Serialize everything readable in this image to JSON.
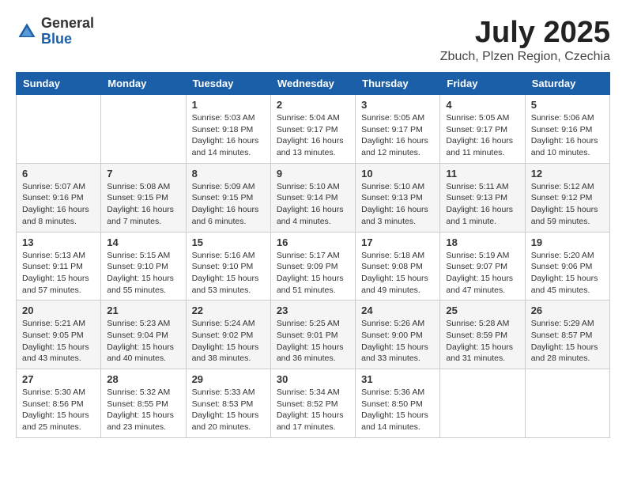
{
  "logo": {
    "general": "General",
    "blue": "Blue"
  },
  "title": "July 2025",
  "location": "Zbuch, Plzen Region, Czechia",
  "headers": [
    "Sunday",
    "Monday",
    "Tuesday",
    "Wednesday",
    "Thursday",
    "Friday",
    "Saturday"
  ],
  "weeks": [
    [
      {
        "day": "",
        "info": ""
      },
      {
        "day": "",
        "info": ""
      },
      {
        "day": "1",
        "info": "Sunrise: 5:03 AM\nSunset: 9:18 PM\nDaylight: 16 hours and 14 minutes."
      },
      {
        "day": "2",
        "info": "Sunrise: 5:04 AM\nSunset: 9:17 PM\nDaylight: 16 hours and 13 minutes."
      },
      {
        "day": "3",
        "info": "Sunrise: 5:05 AM\nSunset: 9:17 PM\nDaylight: 16 hours and 12 minutes."
      },
      {
        "day": "4",
        "info": "Sunrise: 5:05 AM\nSunset: 9:17 PM\nDaylight: 16 hours and 11 minutes."
      },
      {
        "day": "5",
        "info": "Sunrise: 5:06 AM\nSunset: 9:16 PM\nDaylight: 16 hours and 10 minutes."
      }
    ],
    [
      {
        "day": "6",
        "info": "Sunrise: 5:07 AM\nSunset: 9:16 PM\nDaylight: 16 hours and 8 minutes."
      },
      {
        "day": "7",
        "info": "Sunrise: 5:08 AM\nSunset: 9:15 PM\nDaylight: 16 hours and 7 minutes."
      },
      {
        "day": "8",
        "info": "Sunrise: 5:09 AM\nSunset: 9:15 PM\nDaylight: 16 hours and 6 minutes."
      },
      {
        "day": "9",
        "info": "Sunrise: 5:10 AM\nSunset: 9:14 PM\nDaylight: 16 hours and 4 minutes."
      },
      {
        "day": "10",
        "info": "Sunrise: 5:10 AM\nSunset: 9:13 PM\nDaylight: 16 hours and 3 minutes."
      },
      {
        "day": "11",
        "info": "Sunrise: 5:11 AM\nSunset: 9:13 PM\nDaylight: 16 hours and 1 minute."
      },
      {
        "day": "12",
        "info": "Sunrise: 5:12 AM\nSunset: 9:12 PM\nDaylight: 15 hours and 59 minutes."
      }
    ],
    [
      {
        "day": "13",
        "info": "Sunrise: 5:13 AM\nSunset: 9:11 PM\nDaylight: 15 hours and 57 minutes."
      },
      {
        "day": "14",
        "info": "Sunrise: 5:15 AM\nSunset: 9:10 PM\nDaylight: 15 hours and 55 minutes."
      },
      {
        "day": "15",
        "info": "Sunrise: 5:16 AM\nSunset: 9:10 PM\nDaylight: 15 hours and 53 minutes."
      },
      {
        "day": "16",
        "info": "Sunrise: 5:17 AM\nSunset: 9:09 PM\nDaylight: 15 hours and 51 minutes."
      },
      {
        "day": "17",
        "info": "Sunrise: 5:18 AM\nSunset: 9:08 PM\nDaylight: 15 hours and 49 minutes."
      },
      {
        "day": "18",
        "info": "Sunrise: 5:19 AM\nSunset: 9:07 PM\nDaylight: 15 hours and 47 minutes."
      },
      {
        "day": "19",
        "info": "Sunrise: 5:20 AM\nSunset: 9:06 PM\nDaylight: 15 hours and 45 minutes."
      }
    ],
    [
      {
        "day": "20",
        "info": "Sunrise: 5:21 AM\nSunset: 9:05 PM\nDaylight: 15 hours and 43 minutes."
      },
      {
        "day": "21",
        "info": "Sunrise: 5:23 AM\nSunset: 9:04 PM\nDaylight: 15 hours and 40 minutes."
      },
      {
        "day": "22",
        "info": "Sunrise: 5:24 AM\nSunset: 9:02 PM\nDaylight: 15 hours and 38 minutes."
      },
      {
        "day": "23",
        "info": "Sunrise: 5:25 AM\nSunset: 9:01 PM\nDaylight: 15 hours and 36 minutes."
      },
      {
        "day": "24",
        "info": "Sunrise: 5:26 AM\nSunset: 9:00 PM\nDaylight: 15 hours and 33 minutes."
      },
      {
        "day": "25",
        "info": "Sunrise: 5:28 AM\nSunset: 8:59 PM\nDaylight: 15 hours and 31 minutes."
      },
      {
        "day": "26",
        "info": "Sunrise: 5:29 AM\nSunset: 8:57 PM\nDaylight: 15 hours and 28 minutes."
      }
    ],
    [
      {
        "day": "27",
        "info": "Sunrise: 5:30 AM\nSunset: 8:56 PM\nDaylight: 15 hours and 25 minutes."
      },
      {
        "day": "28",
        "info": "Sunrise: 5:32 AM\nSunset: 8:55 PM\nDaylight: 15 hours and 23 minutes."
      },
      {
        "day": "29",
        "info": "Sunrise: 5:33 AM\nSunset: 8:53 PM\nDaylight: 15 hours and 20 minutes."
      },
      {
        "day": "30",
        "info": "Sunrise: 5:34 AM\nSunset: 8:52 PM\nDaylight: 15 hours and 17 minutes."
      },
      {
        "day": "31",
        "info": "Sunrise: 5:36 AM\nSunset: 8:50 PM\nDaylight: 15 hours and 14 minutes."
      },
      {
        "day": "",
        "info": ""
      },
      {
        "day": "",
        "info": ""
      }
    ]
  ]
}
